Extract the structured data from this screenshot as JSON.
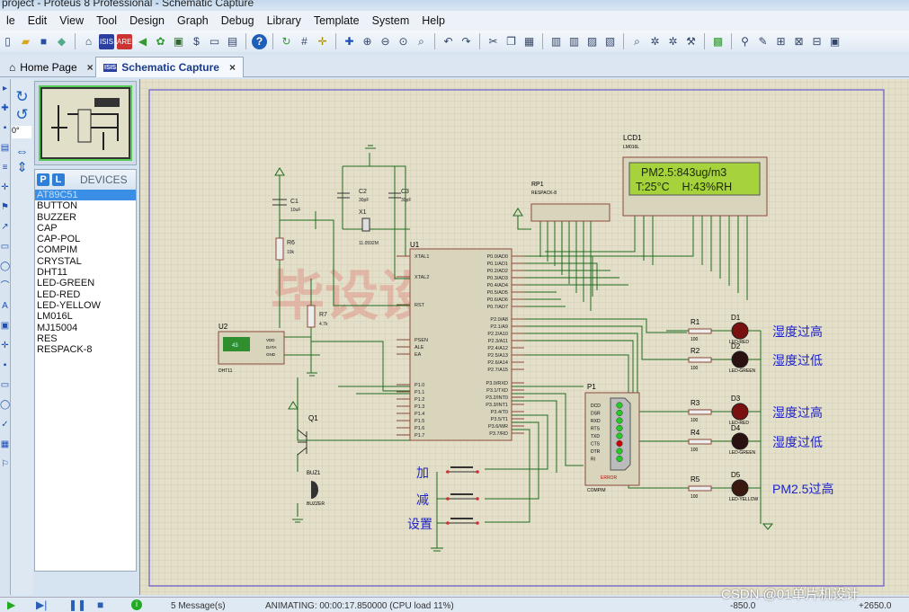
{
  "window": {
    "title": "project - Proteus 8 Professional - Schematic Capture"
  },
  "menu": [
    "le",
    "Edit",
    "View",
    "Tool",
    "Design",
    "Graph",
    "Debug",
    "Library",
    "Template",
    "System",
    "Help"
  ],
  "tabs": [
    {
      "label": "Home Page",
      "close": "×",
      "icon": "home-icon"
    },
    {
      "label": "Schematic Capture",
      "close": "×",
      "icon": "isis-icon",
      "active": true
    }
  ],
  "left_tools": {
    "rotation": "0°"
  },
  "devices": {
    "p_button": "P",
    "l_button": "L",
    "header": "DEVICES",
    "items": [
      "AT89C51",
      "BUTTON",
      "BUZZER",
      "CAP",
      "CAP-POL",
      "COMPIM",
      "CRYSTAL",
      "DHT11",
      "LED-GREEN",
      "LED-RED",
      "LED-YELLOW",
      "LM016L",
      "MJ15004",
      "RES",
      "RESPACK-8"
    ],
    "selected": "AT89C51"
  },
  "schematic": {
    "lcd": {
      "ref": "LCD1",
      "model": "LM016L",
      "line1": "PM2.5:843ug/m3",
      "line2": "T:25°C    H:43%RH",
      "text": "<TEXT>"
    },
    "rp1": {
      "ref": "RP1",
      "model": "RESPACK-8"
    },
    "u1": {
      "ref": "U1",
      "left_pins": [
        "XTAL1",
        "XTAL2",
        "RST",
        "PSEN",
        "ALE",
        "EA",
        "P1.0",
        "P1.1",
        "P1.2",
        "P1.3",
        "P1.4",
        "P1.5",
        "P1.6",
        "P1.7"
      ],
      "right_pins": [
        "P0.0/AD0",
        "P0.1/AD1",
        "P0.2/AD2",
        "P0.3/AD3",
        "P0.4/AD4",
        "P0.5/AD5",
        "P0.6/AD6",
        "P0.7/AD7",
        "P2.0/A8",
        "P2.1/A9",
        "P2.2/A10",
        "P2.3/A11",
        "P2.4/A12",
        "P2.5/A13",
        "P2.6/A14",
        "P2.7/A15",
        "P3.0/RXD",
        "P3.1/TXD",
        "P3.2/INT0",
        "P3.3/INT1",
        "P3.4/T0",
        "P3.5/T1",
        "P3.6/WR",
        "P3.7/RD"
      ]
    },
    "c1": {
      "ref": "C1",
      "value": "10uF"
    },
    "c2": {
      "ref": "C2",
      "value": "30pF"
    },
    "c3": {
      "ref": "C3",
      "value": "30pF"
    },
    "x1": {
      "ref": "X1",
      "value": "11.0592M"
    },
    "r6": {
      "ref": "R6",
      "value": "10k"
    },
    "r7": {
      "ref": "R7",
      "value": "4.7k"
    },
    "u2": {
      "ref": "U2",
      "model": "DHT11",
      "reading": "43",
      "pins": [
        "VDD",
        "DATA",
        "GND"
      ]
    },
    "q1": {
      "ref": "Q1"
    },
    "buzzer": {
      "ref": "BUZ1",
      "model": "BUZZER"
    },
    "p1": {
      "ref": "P1",
      "model": "COMPIM",
      "pins": [
        "DCD",
        "DSR",
        "RXD",
        "RTS",
        "TXD",
        "CTS",
        "DTR",
        "RI"
      ],
      "error": "ERROR"
    },
    "leds": [
      {
        "r": "R1",
        "rv": "100",
        "d": "D1",
        "model": "LED-RED",
        "label": "湿度过高"
      },
      {
        "r": "R2",
        "rv": "100",
        "d": "D2",
        "model": "LED-GREEN",
        "label": "湿度过低"
      },
      {
        "r": "R3",
        "rv": "100",
        "d": "D3",
        "model": "LED-RED",
        "label": "湿度过高"
      },
      {
        "r": "R4",
        "rv": "100",
        "d": "D4",
        "model": "LED-GREEN",
        "label": "湿度过低"
      },
      {
        "r": "R5",
        "rv": "100",
        "d": "D5",
        "model": "LED-YELLOW",
        "label": "PM2.5过高"
      }
    ],
    "buttons": [
      "加",
      "减",
      "设置"
    ],
    "watermark": "毕设设计"
  },
  "status": {
    "messages": "5 Message(s)",
    "animating": "ANIMATING: 00:00:17.850000 (CPU load 11%)",
    "coord_x": "-850.0",
    "coord_y": "+2650.0",
    "credit": "CSDN @01单片机设计"
  },
  "colors": {
    "canvas": "#e3dfc8",
    "grid": "#cfcbb4",
    "wire": "#1f6b1f",
    "border": "#6a5acd",
    "lcd_screen": "#a6d23b",
    "label_blue": "#1e22c8"
  }
}
